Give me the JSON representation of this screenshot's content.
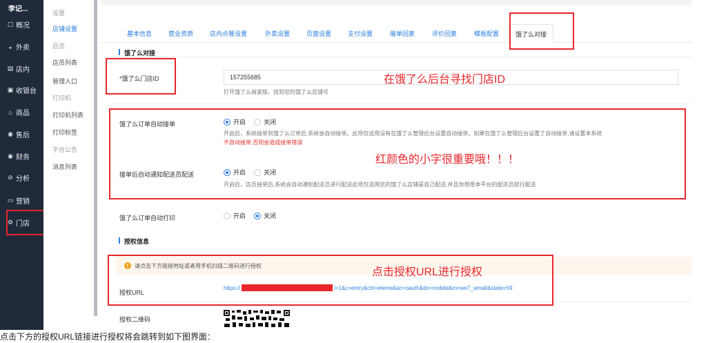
{
  "sidebar": {
    "brand": "李记...",
    "items": [
      {
        "label": "概况",
        "icon": "dashboard-icon",
        "glyph": "▢"
      },
      {
        "label": "外卖",
        "icon": "takeout-icon",
        "glyph": "◒"
      },
      {
        "label": "店内",
        "icon": "dine-in-icon",
        "glyph": "▤"
      },
      {
        "label": "收银台",
        "icon": "cashier-icon",
        "glyph": "▣"
      },
      {
        "label": "商品",
        "icon": "goods-icon",
        "glyph": "⌂"
      },
      {
        "label": "售后",
        "icon": "after-sale-icon",
        "glyph": "◉"
      },
      {
        "label": "财务",
        "icon": "finance-icon",
        "glyph": "◉"
      },
      {
        "label": "分析",
        "icon": "analysis-icon",
        "glyph": "⊘"
      },
      {
        "label": "营销",
        "icon": "marketing-icon",
        "glyph": "▭"
      },
      {
        "label": "门店",
        "icon": "store-gear-icon",
        "glyph": "⚙"
      }
    ]
  },
  "submenu": {
    "settings_group": "设置",
    "store_settings": "店铺设置",
    "clerk_group": "店员",
    "clerk_list": "店员列表",
    "manage_entry": "管理入口",
    "printer_group": "打印机",
    "printer_list": "打印机列表",
    "print_label": "打印标签",
    "notice_group": "平台公告",
    "message_list": "消息列表"
  },
  "tabs": [
    "基本信息",
    "营业资质",
    "店内点餐设置",
    "外卖设置",
    "页面设置",
    "支付设置",
    "催单回复",
    "评价回复",
    "模板配置",
    "饿了么对接"
  ],
  "eleme_section": {
    "title": "饿了么对接",
    "store_id_label": "*饿了么门店ID",
    "store_id_value": "157255685",
    "store_id_hint": "打开饿了么商家版，找到您的饿了么店铺号",
    "auto_accept_label": "饿了么订单自动接单",
    "auto_accept_hint_gray": "开启后，系统接单到饿了么订单后,系统会自动接单。此项仅适用没有在饿了么管理后台设置自动接单。如果在饿了么管理后台设置了自动接单,请设置本系统",
    "auto_accept_hint_red": "不自动接单,否则会造成接单错误",
    "notify_label": "接单后自动通知配送员配送",
    "notify_hint": "开启后，店员接单后,系统会自动通知配送员进行配送此项仅适用您的饿了么店铺是自己配送,并且你想用本平台的配送员就行配送",
    "auto_print_label": "饿了么订单自动打印",
    "opt_on": "开启",
    "opt_off": "关闭"
  },
  "auth_section": {
    "title": "授权信息",
    "notice": "请点击下方链接地址或者用手机扫描二维码进行授权",
    "url_label": "授权URL",
    "url_prefix": "https://",
    "url_suffix": "i=1&c=entry&ctrl=eleme&ac=oauth&do=mobile&m=we7_wmall&state=59",
    "qr_label": "授权二维码"
  },
  "annotations": {
    "store_id": "在饿了么后台寻找门店ID",
    "red_text": "红颜色的小字很重要哦！！！",
    "auth_url": "点击授权URL进行授权"
  },
  "caption": "点击下方的授权URL链接进行授权将会跳转到如下图界面：",
  "colors": {
    "accent": "#2a7de1",
    "annotation": "#e8262c",
    "sidebar": "#1f2a3a"
  }
}
